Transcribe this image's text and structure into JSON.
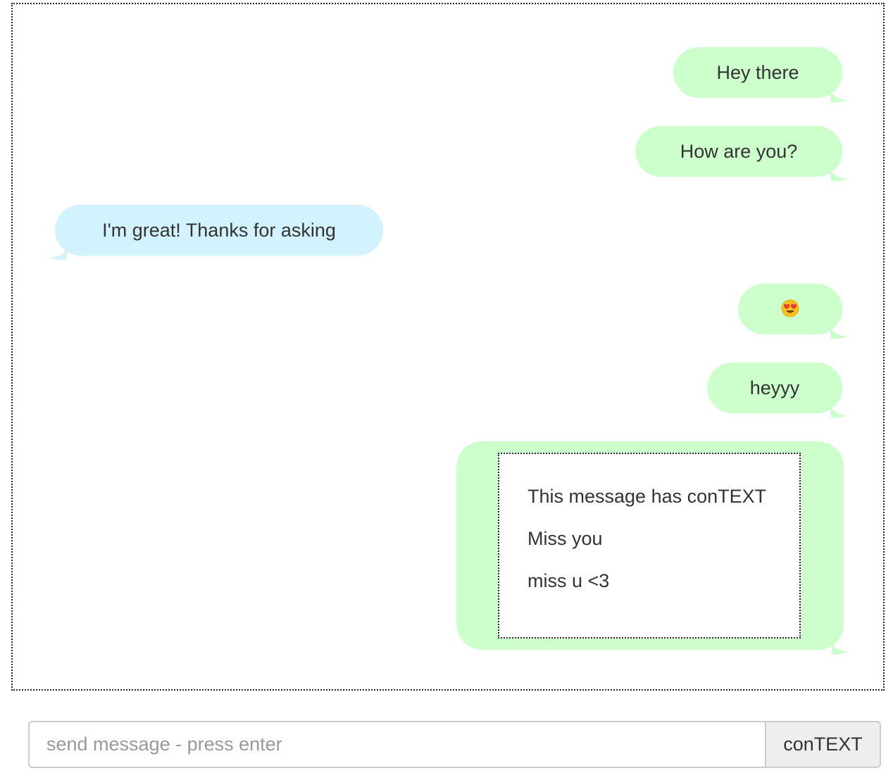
{
  "conversation": {
    "messages": [
      {
        "side": "sent",
        "text": "Hey there"
      },
      {
        "side": "sent",
        "text": "How are you?"
      },
      {
        "side": "received",
        "text": "I'm great! Thanks for asking"
      },
      {
        "side": "sent",
        "emoji": "heart-eyes-emoji"
      },
      {
        "side": "sent",
        "text": "heyyy"
      }
    ],
    "context_message": {
      "lines": [
        "This message has conTEXT",
        "Miss you",
        "miss u <3"
      ]
    }
  },
  "composer": {
    "placeholder": "send message - press enter",
    "value": "",
    "button_label": "conTEXT"
  },
  "colors": {
    "sent_bubble": "#ccffcc",
    "received_bubble": "#d2f2fd"
  }
}
